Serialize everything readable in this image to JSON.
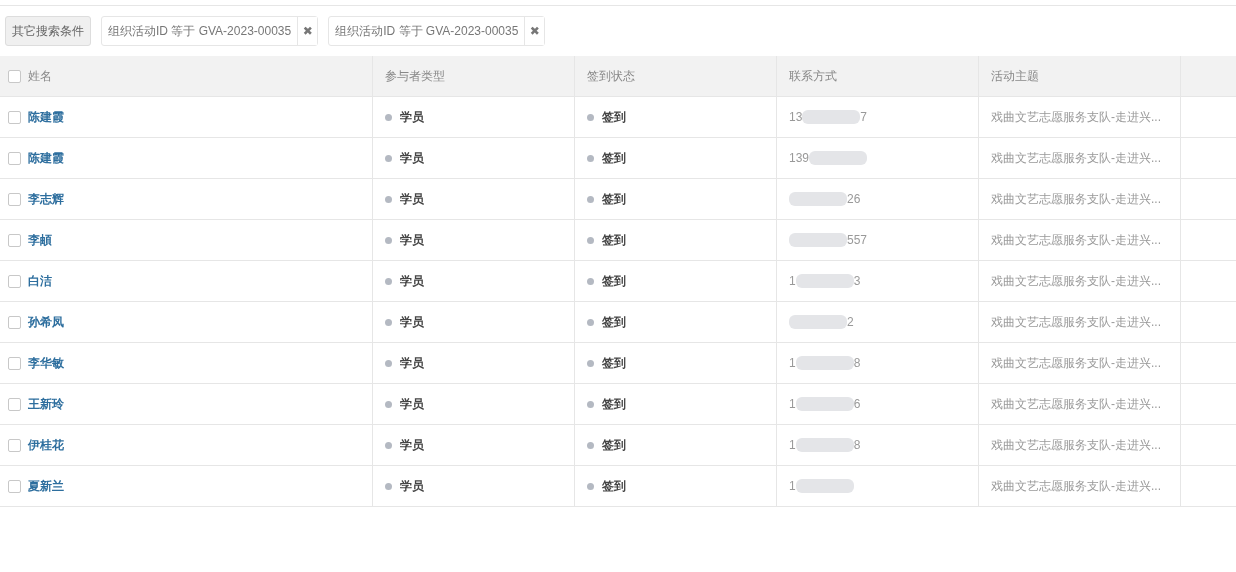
{
  "filters": {
    "more_button": "其它搜索条件",
    "tags": [
      {
        "label": "组织活动ID 等于 GVA-2023-00035",
        "remove": "✖"
      },
      {
        "label": "组织活动ID 等于 GVA-2023-00035",
        "remove": "✖"
      }
    ]
  },
  "table": {
    "select_all": {
      "checked": false
    },
    "columns": [
      "姓名",
      "参与者类型",
      "签到状态",
      "联系方式",
      "活动主题"
    ],
    "rows": [
      {
        "checked": false,
        "name": "陈建霞",
        "type": {
          "label": "学员",
          "color": "#b4b9c2"
        },
        "status": {
          "label": "签到",
          "color": "#b4b9c2"
        },
        "phone": {
          "prefix": "13",
          "suffix": "7"
        },
        "theme": "戏曲文艺志愿服务支队-走进兴..."
      },
      {
        "checked": false,
        "name": "陈建霞",
        "type": {
          "label": "学员",
          "color": "#b4b9c2"
        },
        "status": {
          "label": "签到",
          "color": "#b4b9c2"
        },
        "phone": {
          "prefix": "139"
        },
        "theme": "戏曲文艺志愿服务支队-走进兴..."
      },
      {
        "checked": false,
        "name": "李志辉",
        "type": {
          "label": "学员",
          "color": "#b4b9c2"
        },
        "status": {
          "label": "签到",
          "color": "#b4b9c2"
        },
        "phone": {
          "suffix": "26"
        },
        "theme": "戏曲文艺志愿服务支队-走进兴..."
      },
      {
        "checked": false,
        "name": "李頔",
        "type": {
          "label": "学员",
          "color": "#b4b9c2"
        },
        "status": {
          "label": "签到",
          "color": "#b4b9c2"
        },
        "phone": {
          "suffix": "557"
        },
        "theme": "戏曲文艺志愿服务支队-走进兴..."
      },
      {
        "checked": false,
        "name": "白洁",
        "type": {
          "label": "学员",
          "color": "#b4b9c2"
        },
        "status": {
          "label": "签到",
          "color": "#b4b9c2"
        },
        "phone": {
          "prefix": "1",
          "suffix": "3"
        },
        "theme": "戏曲文艺志愿服务支队-走进兴..."
      },
      {
        "checked": false,
        "name": "孙希凤",
        "type": {
          "label": "学员",
          "color": "#b4b9c2"
        },
        "status": {
          "label": "签到",
          "color": "#b4b9c2"
        },
        "phone": {
          "suffix": "2"
        },
        "theme": "戏曲文艺志愿服务支队-走进兴..."
      },
      {
        "checked": false,
        "name": "李华敏",
        "type": {
          "label": "学员",
          "color": "#b4b9c2"
        },
        "status": {
          "label": "签到",
          "color": "#b4b9c2"
        },
        "phone": {
          "prefix": "1",
          "suffix": "8"
        },
        "theme": "戏曲文艺志愿服务支队-走进兴..."
      },
      {
        "checked": false,
        "name": "王新玲",
        "type": {
          "label": "学员",
          "color": "#b4b9c2"
        },
        "status": {
          "label": "签到",
          "color": "#b4b9c2"
        },
        "phone": {
          "prefix": "1",
          "suffix": "6"
        },
        "theme": "戏曲文艺志愿服务支队-走进兴..."
      },
      {
        "checked": false,
        "name": "伊桂花",
        "type": {
          "label": "学员",
          "color": "#b4b9c2"
        },
        "status": {
          "label": "签到",
          "color": "#b4b9c2"
        },
        "phone": {
          "prefix": "1",
          "suffix": "8"
        },
        "theme": "戏曲文艺志愿服务支队-走进兴..."
      },
      {
        "checked": false,
        "name": "夏新兰",
        "type": {
          "label": "学员",
          "color": "#b4b9c2"
        },
        "status": {
          "label": "签到",
          "color": "#b4b9c2"
        },
        "phone": {
          "prefix": "1"
        },
        "theme": "戏曲文艺志愿服务支队-走进兴..."
      }
    ]
  }
}
